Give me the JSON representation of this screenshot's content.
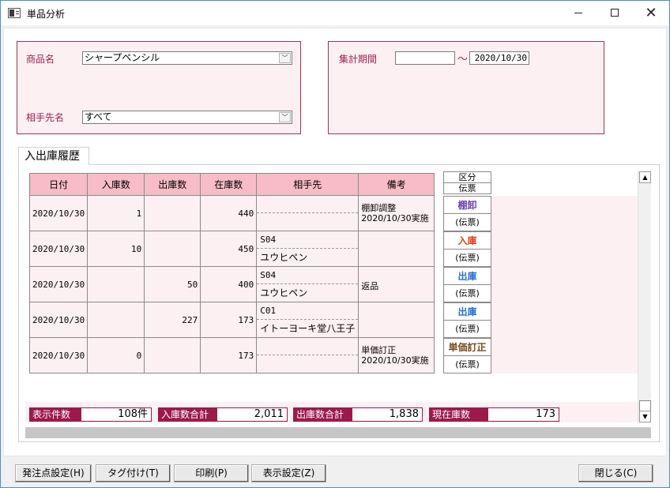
{
  "window": {
    "title": "単品分析",
    "icon": "app-window-icon"
  },
  "filters": {
    "product_label": "商品名",
    "product_value": "シャープペンシル",
    "partner_label": "相手先名",
    "partner_value": "すべて",
    "period_label": "集計期間",
    "period_from": "",
    "period_to": "2020/10/30",
    "tilde": "～"
  },
  "tab": {
    "label": "入出庫履歴"
  },
  "table": {
    "headers": [
      "日付",
      "入庫数",
      "出庫数",
      "在庫数",
      "相手先",
      "備考"
    ],
    "kubun_header": [
      "区分",
      "伝票"
    ],
    "rows": [
      {
        "date": "2020/10/30",
        "in": "1",
        "out": "",
        "stock": "440",
        "partner_code": "",
        "partner_name": "",
        "remark1": "棚卸調整",
        "remark2": "2020/10/30実施",
        "type": "棚卸",
        "type_color": "#6a3fb5",
        "slip": "(伝票)"
      },
      {
        "date": "2020/10/30",
        "in": "10",
        "out": "",
        "stock": "450",
        "partner_code": "S04",
        "partner_name": "ユウヒペン",
        "remark1": "",
        "remark2": "",
        "type": "入庫",
        "type_color": "#e0401a",
        "slip": "(伝票)"
      },
      {
        "date": "2020/10/30",
        "in": "",
        "out": "50",
        "stock": "400",
        "partner_code": "S04",
        "partner_name": "ユウヒペン",
        "remark1": "返品",
        "remark2": "",
        "type": "出庫",
        "type_color": "#2a6fd6",
        "slip": "(伝票)"
      },
      {
        "date": "2020/10/30",
        "in": "",
        "out": "227",
        "stock": "173",
        "partner_code": "C01",
        "partner_name": "イトーヨーキ堂八王子",
        "remark1": "",
        "remark2": "",
        "type": "出庫",
        "type_color": "#2a6fd6",
        "slip": "(伝票)"
      },
      {
        "date": "2020/10/30",
        "in": "0",
        "out": "",
        "stock": "173",
        "partner_code": "",
        "partner_name": "",
        "remark1": "単価訂正",
        "remark2": "2020/10/30実施",
        "type": "単価訂正",
        "type_color": "#7a4a1a",
        "slip": "(伝票)"
      }
    ]
  },
  "summary": {
    "count_label": "表示件数",
    "count_value": "108件",
    "in_total_label": "入庫数合計",
    "in_total_value": "2,011",
    "out_total_label": "出庫数合計",
    "out_total_value": "1,838",
    "stock_label": "現在庫数",
    "stock_value": "173"
  },
  "buttons": {
    "reorder": "発注点設定(H)",
    "tag": "タグ付け(T)",
    "print": "印刷(P)",
    "display": "表示設定(Z)",
    "close": "閉じる(C)"
  },
  "colors": {
    "accent": "#9c1a4a",
    "header_bg": "#f7bcc6",
    "row_bg": "#fdf0f3"
  }
}
